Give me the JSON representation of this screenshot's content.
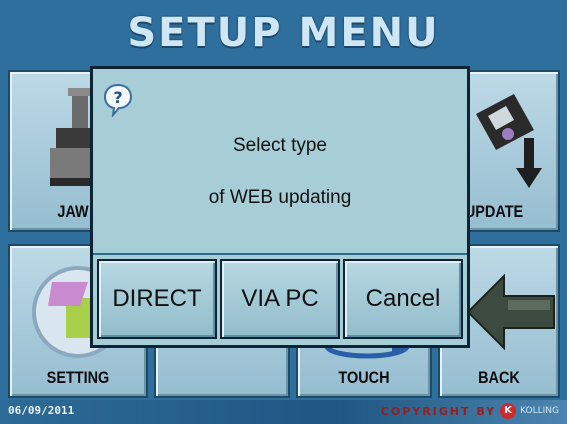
{
  "screen": {
    "title": "SETUP MENU",
    "date": "06/09/2011",
    "copyright": "COPYRIGHT BY",
    "brand_logo_letter": "K",
    "brand_name": "KOLLING"
  },
  "tiles": [
    {
      "label": "JAW",
      "icon": "jaw-press-icon"
    },
    {
      "label": "UPDATE",
      "icon": "floppy-disk-download-icon"
    },
    {
      "label": "SETTING",
      "icon": "settings-disc-icon"
    },
    {
      "label": "",
      "icon": ""
    },
    {
      "label": "TOUCH",
      "icon": "touch-calibration-icon"
    },
    {
      "label": "BACK",
      "icon": "back-arrow-icon"
    }
  ],
  "dialog": {
    "icon": "question-icon",
    "message_line1": "Select type",
    "message_line2": "of WEB updating",
    "buttons": [
      "DIRECT",
      "VIA PC",
      "Cancel"
    ]
  },
  "colors": {
    "background": "#2f6f9e",
    "tile": "#a9cddd",
    "dialog": "#a7cdd7",
    "dialog_border": "#0d2436",
    "copyright_text": "#9c1c1c"
  }
}
